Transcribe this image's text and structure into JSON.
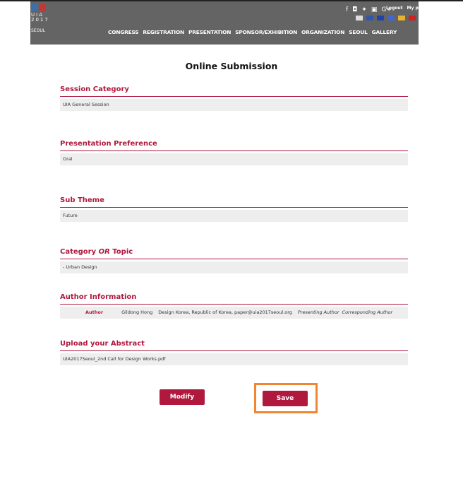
{
  "header": {
    "logo_text": "UIA 2017",
    "logo_sub": "SEOUL",
    "social_icons": [
      "facebook-icon",
      "instagram-icon",
      "twitter-icon",
      "youtube-icon",
      "google-plus-icon"
    ],
    "top_links": [
      "Logout",
      "My page"
    ],
    "nav_items": [
      "CONGRESS",
      "REGISTRATION",
      "PRESENTATION",
      "SPONSOR/EXHIBITION",
      "ORGANIZATION",
      "SEOUL",
      "GALLERY"
    ],
    "google_plus": "G+"
  },
  "page_title": "Online Submission",
  "sections": {
    "session_category": {
      "label": "Session Category",
      "value": "UIA General Session"
    },
    "presentation_preference": {
      "label": "Presentation Preference",
      "value": "Oral"
    },
    "sub_theme": {
      "label": "Sub Theme",
      "value": "Future"
    },
    "category_topic": {
      "label_pre": "Category ",
      "label_or": "OR",
      "label_post": " Topic",
      "value": "- Urban Design"
    },
    "author_information": {
      "label": "Author Information",
      "author_label": "Author",
      "name": "Gildong Hong",
      "affiliation": "Design Korea, Republic of Korea,",
      "email": "paper@uia2017seoul.org",
      "role1": "Presenting Author",
      "role2": "Corresponding Author"
    },
    "upload_abstract": {
      "label": "Upload your Abstract",
      "value": "UIA2017Seoul_2nd Call for Design Works.pdf"
    }
  },
  "buttons": {
    "modify": "Modify",
    "save": "Save"
  },
  "colors": {
    "accent": "#b0183e",
    "header_bg": "#646464",
    "highlight": "#f08632"
  }
}
